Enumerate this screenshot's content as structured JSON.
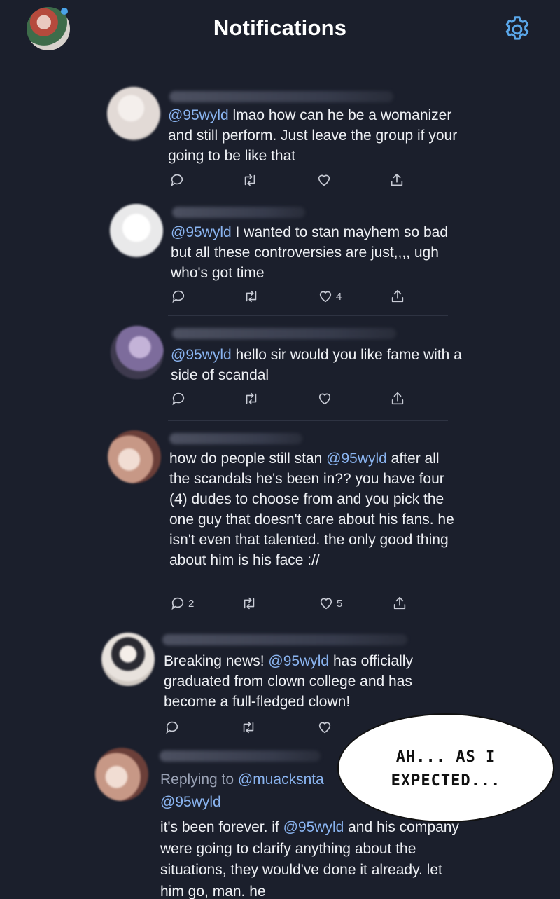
{
  "header": {
    "title": "Notifications",
    "settings_icon": "gear-icon"
  },
  "tweets": [
    {
      "body": [
        {
          "t": "@95wyld",
          "m": true
        },
        {
          "t": " lmao how can he be a womanizer and still perform. Just leave the group if your going to be like that",
          "m": false
        }
      ],
      "reply_count": "",
      "retweet_count": "",
      "like_count": ""
    },
    {
      "body": [
        {
          "t": "@95wyld",
          "m": true
        },
        {
          "t": "  I wanted to stan mayhem so bad but all these controversies are just,,,, ugh who's got time",
          "m": false
        }
      ],
      "reply_count": "",
      "retweet_count": "",
      "like_count": "4"
    },
    {
      "body": [
        {
          "t": "@95wyld",
          "m": true
        },
        {
          "t": " hello sir would you like fame with a side of scandal",
          "m": false
        }
      ],
      "reply_count": "",
      "retweet_count": "",
      "like_count": ""
    },
    {
      "body": [
        {
          "t": "how do people still stan ",
          "m": false
        },
        {
          "t": "@95wyld",
          "m": true
        },
        {
          "t": " after all the scandals he's been in?? you have four (4) dudes to choose from and you pick the one guy that doesn't care about his fans. he isn't even that talented. the only good thing about him is his face ://",
          "m": false
        }
      ],
      "reply_count": "2",
      "retweet_count": "",
      "like_count": "5"
    },
    {
      "body": [
        {
          "t": "Breaking news! ",
          "m": false
        },
        {
          "t": "@95wyld",
          "m": true
        },
        {
          "t": " has officially graduated from clown college and has become a full-fledged clown!",
          "m": false
        }
      ],
      "reply_count": "",
      "retweet_count": "",
      "like_count": ""
    },
    {
      "replying_prefix": "Replying to ",
      "replying_to": "@muacksnta",
      "replying_to_2": "@95wyld",
      "body": [
        {
          "t": "it's been forever. if ",
          "m": false
        },
        {
          "t": "@95wyld",
          "m": true
        },
        {
          "t": " and his company were going to clarify anything about the situations, they would've done it already. let him go, man. he",
          "m": false
        }
      ]
    }
  ],
  "bubble": {
    "line1": "AH... AS I",
    "line2": "EXPECTED..."
  }
}
